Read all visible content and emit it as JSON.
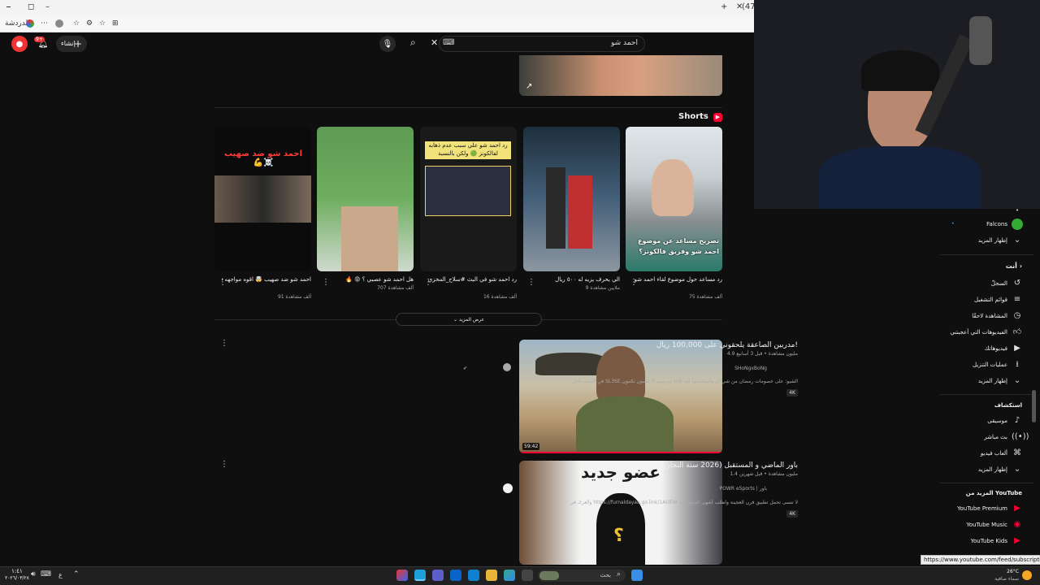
{
  "browser": {
    "tab_count": "(47)",
    "sidebar_label": "الدردشة"
  },
  "header": {
    "create_label": "إنشاء",
    "notif_count": "9+",
    "search_query": "احمد شو",
    "kbd_glyph": "⌨"
  },
  "shorts": {
    "section_title": "Shorts",
    "show_more": "عرض المزيد",
    "items": [
      {
        "title": "رد مساعد حول موضوع لقاء احمد شو في بلوبر 🤯 #بندريتا #ريال #لحرب...",
        "views": "75 ألف مشاهدة",
        "caption": "تصريح مساعد عن موضوع احمد شو وفريق فالكونز؟"
      },
      {
        "title": "الي يحرف يزيه له ٥٠٠ ريال",
        "views": "9 ملايين مشاهدة",
        "caption": ""
      },
      {
        "title": "رد احمد شو في البث #سلاح_المخزي #رابي_لله #شرقي #الكوكز #بندريتا ...",
        "views": "16 ألف مشاهدة",
        "caption": "رد احمد شو علي سبب عدم ذهابه لفالكونز 🟢 ولكن بالنسبة"
      },
      {
        "title": "هل احمد شو عصبي ؟ 😡 🔥",
        "views": "707 ألف مشاهدة",
        "caption": ""
      },
      {
        "title": "احمد شو ضد صهيب 🤯 اقوه مواجهه في شك بور 🤯 #تروي_بور #شك_بور...",
        "views": "91 ألف مشاهدة",
        "caption": "احمد شو ضد صهيب ☠️💪"
      }
    ]
  },
  "videos": [
    {
      "title": "مدربين الصاعقة يلحقوني على 100,000 ريال!",
      "meta": "4.9 مليون مشاهدة • قبل 3 أسابيع",
      "channel": "SHoNgxBoNg",
      "desc": "الشيو: على خصومات رمضان من شي ان واستخدموا كود sxb ويرمسر لا تنسون تكتبون SL3SE في البحث داخل تطبيق شي ان عشان تطلع لكم ...",
      "badge": "4K",
      "duration": "59:42"
    },
    {
      "title": "باور الماضي و المستقبل (2026 سنة التجارب)",
      "meta": "1.4 مليون مشاهدة • قبل شهرين",
      "channel": "POWR eSports | باور",
      "desc": "لا تنسى تحمل تطبيق فرن العجينة واطلب أشهى الصنوبرات https://furnaldayaa.go.link/1AUEW والعرك في الشهر على اليوتيوب",
      "badge": "4K",
      "thumb_text": "عضو جديد"
    }
  ],
  "sidebar": {
    "top_items": [
      {
        "label": "Falcons",
        "icon": "channel-avatar"
      },
      {
        "label": "إظهار المزيد",
        "icon": "chevron-down-icon"
      }
    ],
    "you_header": "أنت",
    "you_items": [
      {
        "label": "السجلّ",
        "icon": "history-icon"
      },
      {
        "label": "قوائم التشغيل",
        "icon": "playlist-icon"
      },
      {
        "label": "المشاهدة لاحقًا",
        "icon": "clock-icon"
      },
      {
        "label": "الفيديوهات التي أعجبتني",
        "icon": "thumbs-up-icon"
      },
      {
        "label": "فيديوهاتك",
        "icon": "video-icon"
      },
      {
        "label": "عمليات التنزيل",
        "icon": "download-icon"
      },
      {
        "label": "إظهار المزيد",
        "icon": "chevron-down-icon"
      }
    ],
    "explore_header": "استكشاف",
    "explore_items": [
      {
        "label": "موسيقى",
        "icon": "music-icon"
      },
      {
        "label": "بث مباشر",
        "icon": "live-icon"
      },
      {
        "label": "ألعاب فيديو",
        "icon": "gaming-icon"
      },
      {
        "label": "إظهار المزيد",
        "icon": "chevron-down-icon"
      }
    ],
    "more_header": "المزيد من YouTube",
    "more_items": [
      {
        "label": "YouTube Premium"
      },
      {
        "label": "YouTube Music"
      },
      {
        "label": "YouTube Kids"
      }
    ]
  },
  "status_url": "https://www.youtube.com/feed/subscriptions",
  "taskbar": {
    "weather_temp": "26°C",
    "weather_desc": "سماء صافية",
    "search_placeholder": "بحث",
    "time": "١:٤١",
    "date": "٢٠٢٦/٠٣/٢٨",
    "lang": "ع"
  },
  "colors": {
    "accent": "#ff0033",
    "bg": "#0f0f0f"
  }
}
